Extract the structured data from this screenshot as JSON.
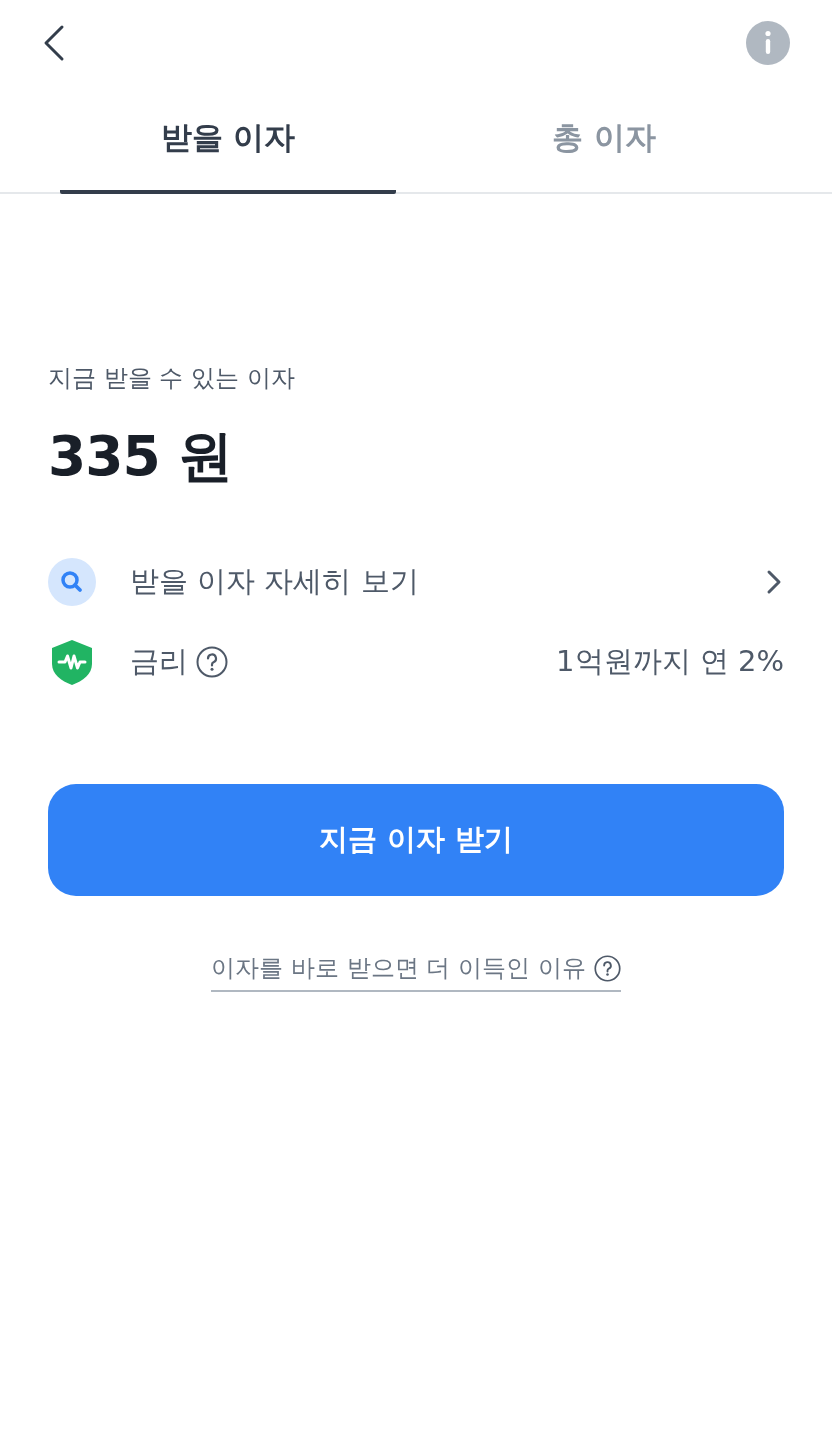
{
  "tabs": [
    {
      "label": "받을 이자",
      "selected": true
    },
    {
      "label": "총 이자",
      "selected": false
    }
  ],
  "summary": {
    "label": "지금 받을 수 있는 이자",
    "amount": "335 원"
  },
  "rows": [
    {
      "kind": "link",
      "label": "받을 이자 자세히 보기"
    },
    {
      "kind": "rate",
      "label": "금리",
      "value": "1억원까지 연 2%"
    }
  ],
  "button": {
    "label": "지금 이자 받기"
  },
  "footer_link": {
    "label": "이자를 바로 받으면 더 이득인 이유"
  }
}
